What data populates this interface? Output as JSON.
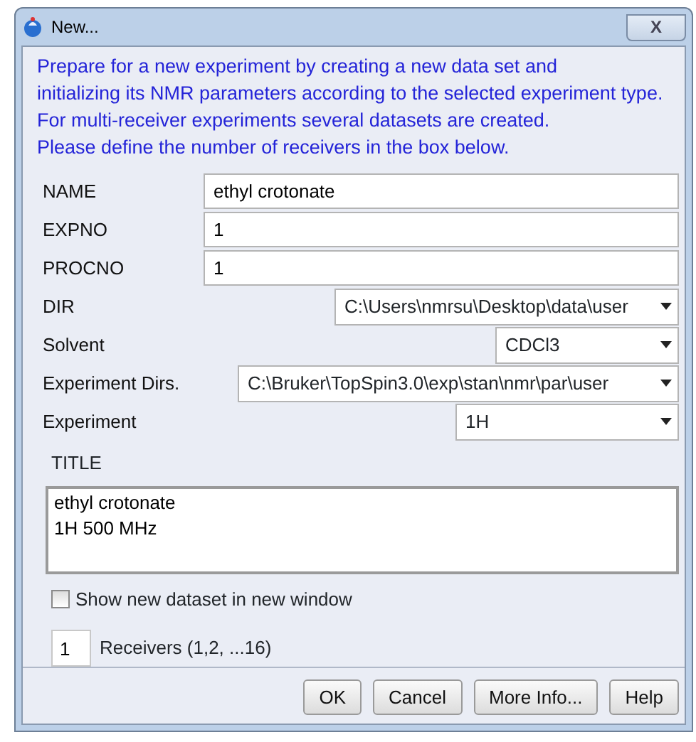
{
  "window": {
    "title": "New...",
    "close": "X"
  },
  "intro": [
    "Prepare for a new experiment by creating a new data set and",
    "initializing its NMR parameters according to the selected experiment type.",
    "For multi-receiver experiments several datasets are created.",
    "Please define the number of receivers in the box below."
  ],
  "fields": [
    {
      "label": "NAME",
      "kind": "text",
      "value": "ethyl crotonate"
    },
    {
      "label": "EXPNO",
      "kind": "text",
      "value": "1"
    },
    {
      "label": "PROCNO",
      "kind": "text",
      "value": "1"
    },
    {
      "label": "DIR",
      "kind": "select",
      "value": "C:\\Users\\nmrsu\\Desktop\\data\\user"
    },
    {
      "label": "Solvent",
      "kind": "select",
      "value": "CDCl3"
    },
    {
      "label": "Experiment Dirs.",
      "kind": "select",
      "value": "C:\\Bruker\\TopSpin3.0\\exp\\stan\\nmr\\par\\user"
    },
    {
      "label": "Experiment",
      "kind": "select",
      "value": "1H"
    }
  ],
  "title_label": "TITLE",
  "title_text": "ethyl crotonate\n1H 500 MHz",
  "show_new_window": {
    "label": "Show new dataset in new window",
    "checked": false
  },
  "receivers": {
    "value": "1",
    "label": "Receivers (1,2, ...16)"
  },
  "buttons": [
    "OK",
    "Cancel",
    "More Info...",
    "Help"
  ]
}
